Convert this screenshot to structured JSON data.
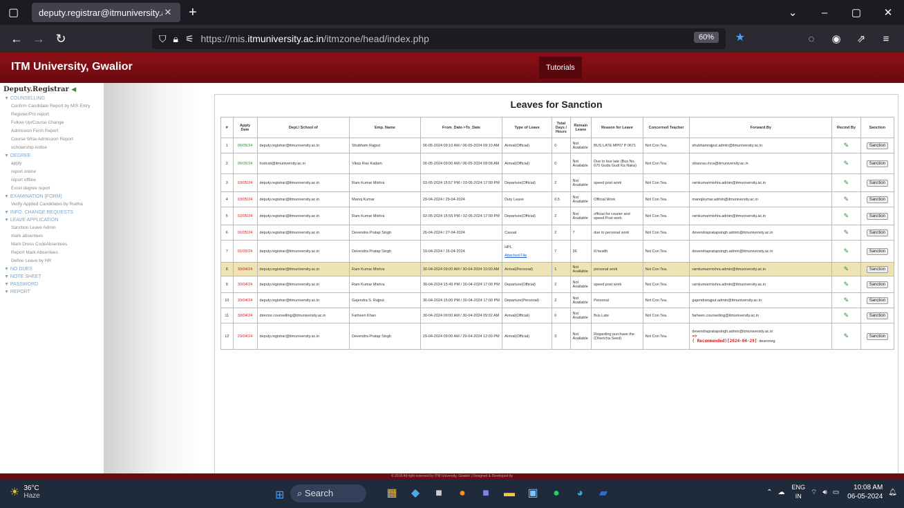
{
  "browser": {
    "tab_title": "deputy.registrar@itmuniversity.ac.in",
    "url_prefix": "https://mis.",
    "url_host": "itmuniversity.ac.in",
    "url_path": "/itmzone/head/index.php",
    "zoom": "60%"
  },
  "site": {
    "title": "ITM University, Gwalior",
    "tutorials": "Tutorials",
    "footer": "© 2018 All right reserved by ITM University, Gwalior | Designed & Developed by"
  },
  "sidebar": {
    "user": "Deputy.Registrar",
    "s1": "▼ COUNSELLING",
    "s1_items": [
      "Confirm Candidate Report by MIS Entry",
      "Register/Pro report",
      "Follow Up/Course Change",
      "Admission Form Report",
      "Course Wise Admission Report",
      "scholarship notice"
    ],
    "s2": "▼ DEGREE",
    "s2_items": [
      "apply",
      "report online",
      "report offline",
      "Excel degree report"
    ],
    "s3": "▼ EXAMINATION (FORM)",
    "s3_items": [
      "Verify Applied Candidates by Rudha"
    ],
    "s4": "▼ INFO. CHANGE REQUESTS",
    "s5": "▼ LEAVE APPLICATION",
    "s5_items": [
      "Sanction Leave Admin",
      "mark absentees",
      "Mark Dress CodeAbsentees",
      "Report Mark Absentees",
      "Define Leave by HR"
    ],
    "s6": "▼ NO DUES",
    "s7": "▼ NOTE SHEET",
    "s8": "▼ PASSWORD",
    "s9": "▼ REPORT"
  },
  "page_title": "Leaves for Sanction",
  "table": {
    "headers": [
      "#",
      "Apply Date",
      "Dept./ School of",
      "Emp. Name",
      "From_Date->To_Date",
      "Type of Leave",
      "Total Days / Hours",
      "Remain Leave",
      "Reason for Leave",
      "Concerned Teacher",
      "Forward By",
      "Recmd By",
      "Sanction"
    ],
    "rows": [
      {
        "n": "1",
        "date": "06/05/24",
        "dept": "deputy.registrar@itmuniversity.ac.in",
        "emp": "Shubham Rajput",
        "range": "06-05-2024 09:10 AM / 06-05-2024 09:10 AM",
        "type": "Arrival(Official)",
        "days": "0",
        "remain": "Not Available",
        "reason": "BUS LATE MP07 P 0671",
        "teacher": "Not Con Tea.",
        "fwd": "shubhamrajput.admin@itmuniversity.ac.in"
      },
      {
        "n": "2",
        "date": "06/05/24",
        "dept": "hodcsit@itmuniversity.ac.in",
        "emp": "Vikas Rao Kadam",
        "range": "06-05-2024 09:00 AM / 06-05-2024 09:08 AM",
        "type": "Arrival(Official)",
        "days": "0",
        "remain": "Not Available",
        "reason": "Due to bus late (Bus No. 670 Guda Gudi Ka Naka)",
        "teacher": "Not Con Tea.",
        "fwd": "vikasrao.mca@itmuniversity.ac.in"
      },
      {
        "n": "3",
        "date": "03/05/24",
        "dept": "deputy.registrar@itmuniversity.ac.in",
        "emp": "Ram Kumar Mishra",
        "range": "03-05-2024 15:57 PM / 03-05-2024 17:00 PM",
        "type": "Departure(Official)",
        "days": "2",
        "remain": "Not Available",
        "reason": "speed post work",
        "teacher": "Not Con Tea.",
        "fwd": "ramkumarmishra.admin@itmuniversity.ac.in"
      },
      {
        "n": "4",
        "date": "03/05/24",
        "dept": "deputy.registrar@itmuniversity.ac.in",
        "emp": "Manoj Kumar",
        "range": "29-04-2024 / 29-04-2024",
        "type": "Duty Leave",
        "days": "0.5",
        "remain": "Not Available",
        "reason": "Official Work",
        "teacher": "Not Con Tea.",
        "fwd": "manojkumar.admin@itmuniversity.ac.in"
      },
      {
        "n": "5",
        "date": "02/05/24",
        "dept": "deputy.registrar@itmuniversity.ac.in",
        "emp": "Ram Kumar Mishra",
        "range": "02-05-2024 15:55 PM / 02-05-2024 17:00 PM",
        "type": "Departure(Official)",
        "days": "2",
        "remain": "Not Available",
        "reason": "official for courier and speed Post work",
        "teacher": "Not Con Tea.",
        "fwd": "ramkumarmishra.admin@itmuniversity.ac.in"
      },
      {
        "n": "6",
        "date": "01/05/24",
        "dept": "deputy.registrar@itmuniversity.ac.in",
        "emp": "Devendra Pratap Singh",
        "range": "26-04-2024 / 27-04-2024",
        "type": "Casual",
        "days": "2",
        "remain": "7",
        "reason": "due to personal work",
        "teacher": "Not Con Tea.",
        "fwd": "devendrapratapsingh.admin@itmuniversity.ac.in"
      },
      {
        "n": "7",
        "date": "01/05/24",
        "dept": "deputy.registrar@itmuniversity.ac.in",
        "emp": "Devendra Pratap Singh",
        "range": "10-04-2024 / 16-04-2024",
        "type": "HPL",
        "type_link": "Attached File",
        "days": "7",
        "remain": "36",
        "reason": "ill health",
        "teacher": "Not Con Tea.",
        "fwd": "devendrapratapsingh.admin@itmuniversity.ac.in"
      },
      {
        "n": "8",
        "date": "30/04/24",
        "dept": "deputy.registrar@itmuniversity.ac.in",
        "emp": "Ram Kumar Mishra",
        "range": "30-04-2024 09:00 AM / 30-04-2024 10:00 AM",
        "type": "Arrival(Personal)",
        "days": "1",
        "remain": "Not Available",
        "reason": "personal work",
        "teacher": "Not Con Tea.",
        "fwd": "ramkumarmishra.admin@itmuniversity.ac.in"
      },
      {
        "n": "9",
        "date": "30/04/24",
        "dept": "deputy.registrar@itmuniversity.ac.in",
        "emp": "Ram Kumar Mishra",
        "range": "30-04-2024 15:49 PM / 30-04-2024 17:00 PM",
        "type": "Departure(Official)",
        "days": "2",
        "remain": "Not Available",
        "reason": "speed post work",
        "teacher": "Not Con Tea.",
        "fwd": "ramkumarmishra.admin@itmuniversity.ac.in"
      },
      {
        "n": "10",
        "date": "30/04/24",
        "dept": "deputy.registrar@itmuniversity.ac.in",
        "emp": "Gajendra S. Rajput",
        "range": "30-04-2024 15:00 PM / 30-04-2024 17:00 PM",
        "type": "Departure(Personal)",
        "days": "2",
        "remain": "Not Available",
        "reason": "Personal",
        "teacher": "Not Con Tea.",
        "fwd": "gajendrarajput.admin@itmuniversity.ac.in"
      },
      {
        "n": "11",
        "date": "30/04/24",
        "dept": "director.counselling@itmuniversity.ac.in",
        "emp": "Farheen Khan",
        "range": "30-04-2024 09:00 AM / 30-04-2024 09:02 AM",
        "type": "Arrival(Official)",
        "days": "0",
        "remain": "Not Available",
        "reason": "Bus Late",
        "teacher": "Not Con Tea.",
        "fwd": "farheen.counselling@itmuniversity.ac.in"
      },
      {
        "n": "12",
        "date": "29/04/24",
        "dept": "deputy.registrar@itmuniversity.ac.in",
        "emp": "Devendra Pratap Singh",
        "range": "29-04-2024 09:00 AM / 29-04-2024 12:00 PM",
        "type": "Arrival(Official)",
        "days": "3",
        "remain": "Not Available",
        "reason": "Regarding purchase the (Dhencha Seed)",
        "teacher": "Not Con Tea.",
        "fwd": "devendrapratapsingh.admin@itmuniversity.ac.in",
        "fwd_arrow": "=>",
        "fwd_rec": "( Recommended)[2024-04-29]",
        "fwd_by": "dearoneg"
      }
    ],
    "sanction_label": "Sanction"
  },
  "taskbar": {
    "temp": "36°C",
    "weather": "Haze",
    "search": "Search",
    "lang1": "ENG",
    "lang2": "IN",
    "time": "10:08 AM",
    "date": "06-05-2024"
  }
}
